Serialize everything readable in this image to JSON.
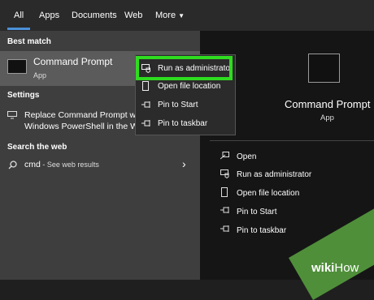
{
  "tabs": [
    "All",
    "Apps",
    "Documents",
    "Web",
    "More"
  ],
  "left": {
    "best_match_heading": "Best match",
    "best_match_title": "Command Prompt",
    "best_match_subtitle": "App",
    "settings_heading": "Settings",
    "settings_item_line1": "Replace Command Prompt w",
    "settings_item_line2": "Windows PowerShell in the W",
    "search_web_heading": "Search the web",
    "web_query": "cmd",
    "web_suffix": " - See web results"
  },
  "right": {
    "title": "Command Prompt",
    "subtitle": "App",
    "actions": [
      "Open",
      "Run as administrator",
      "Open file location",
      "Pin to Start",
      "Pin to taskbar"
    ]
  },
  "context_menu": {
    "items": [
      "Run as administrator",
      "Open file location",
      "Pin to Start",
      "Pin to taskbar"
    ]
  },
  "watermark": {
    "prefix": "wiki",
    "suffix": "How"
  },
  "colors": {
    "highlight": "#2fdc1f",
    "accent": "#4a90d9"
  }
}
